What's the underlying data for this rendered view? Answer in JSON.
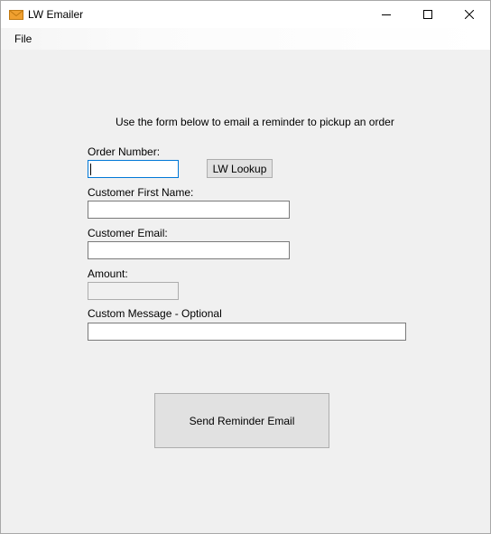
{
  "window": {
    "title": "LW Emailer",
    "icon": "envelope-icon",
    "controls": [
      "minimize-icon",
      "maximize-icon",
      "close-icon"
    ]
  },
  "menu": {
    "items": [
      {
        "label": "File"
      }
    ]
  },
  "form": {
    "instruction": "Use the form below to email a reminder to pickup an order",
    "order_number": {
      "label": "Order Number:",
      "value": ""
    },
    "lookup_button": "LW Lookup",
    "first_name": {
      "label": "Customer First Name:",
      "value": ""
    },
    "email": {
      "label": "Customer Email:",
      "value": ""
    },
    "amount": {
      "label": "Amount:",
      "value": ""
    },
    "custom_message": {
      "label": "Custom Message - Optional",
      "value": ""
    },
    "send_button": "Send Reminder Email"
  },
  "colors": {
    "accent": "#0078d7",
    "icon_orange": "#f0a030"
  }
}
